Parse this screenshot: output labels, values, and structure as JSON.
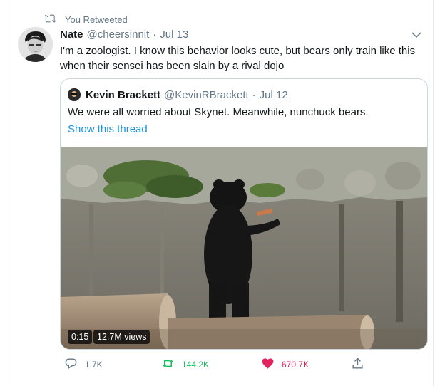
{
  "retweet_banner": {
    "text": "You Retweeted"
  },
  "tweet": {
    "name": "Nate",
    "handle": "@cheersinnit",
    "separator": "·",
    "date": "Jul 13",
    "text": "I'm a zoologist. I know this behavior looks cute, but bears only train like this when their sensei has been slain by a rival dojo"
  },
  "quote": {
    "name": "Kevin Brackett",
    "handle": "@KevinRBrackett",
    "separator": "·",
    "date": "Jul 12",
    "text": "We were all worried about Skynet. Meanwhile, nunchuck bears.",
    "show_thread": "Show this thread",
    "video": {
      "duration": "0:15",
      "views": "12.7M views"
    }
  },
  "actions": {
    "replies": "1.7K",
    "retweets": "144.2K",
    "likes": "670.7K"
  },
  "colors": {
    "retweet_active": "#17bf63",
    "like_active": "#e0245e",
    "link": "#1b95e0",
    "secondary": "#657786"
  },
  "icons": {
    "retweet_banner": "retweet-icon",
    "menu": "chevron-down-icon",
    "reply": "reply-icon",
    "retweet": "retweet-icon",
    "like": "heart-icon",
    "share": "share-icon"
  }
}
